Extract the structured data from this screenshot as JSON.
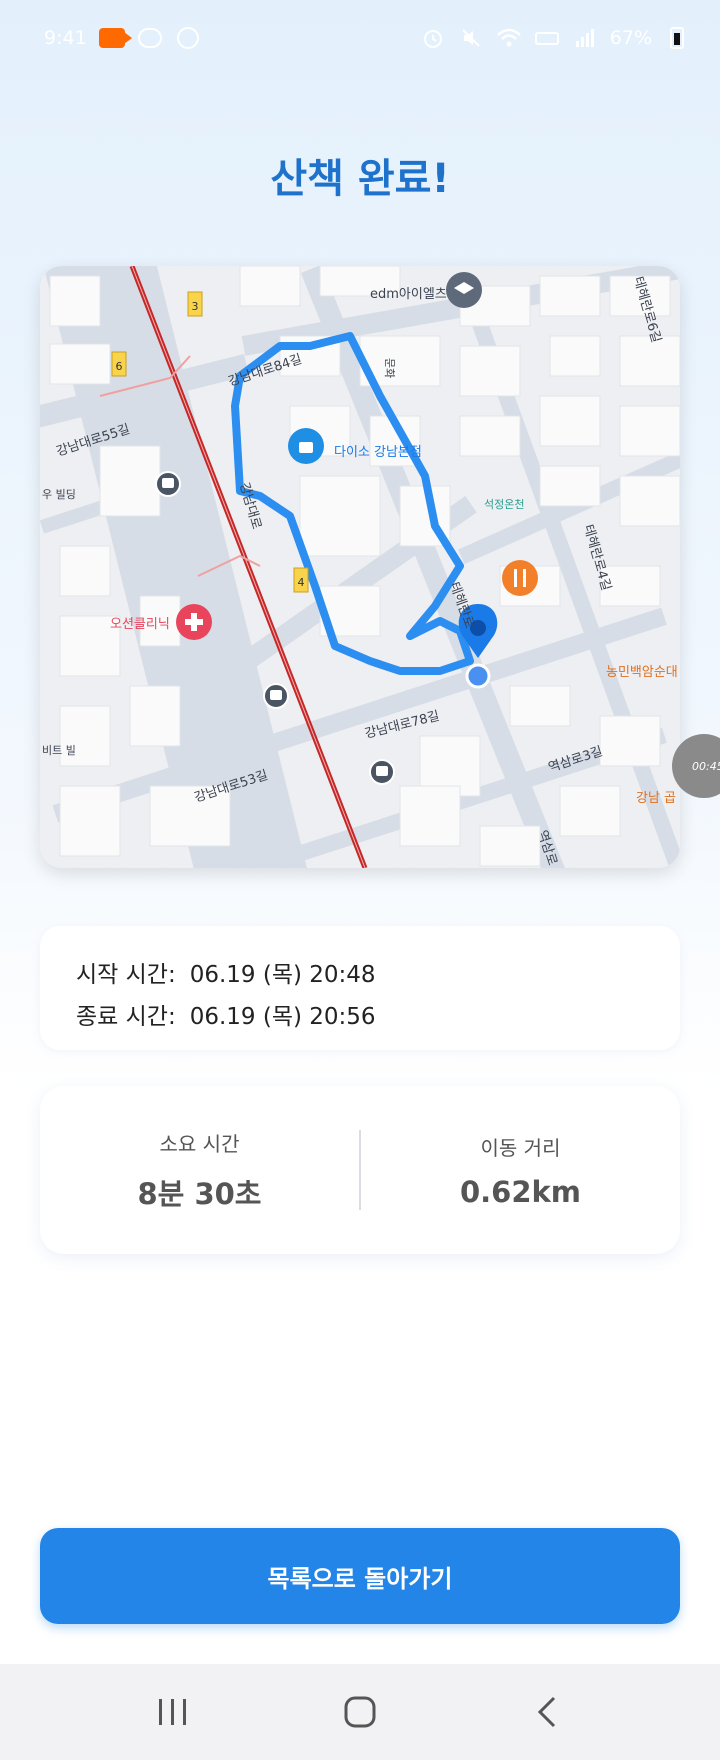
{
  "status_bar": {
    "time": "9:41",
    "battery": "67%"
  },
  "title": "산책 완료!",
  "map": {
    "labels": {
      "road_84": "강남대로84길",
      "road_55": "강남대로55길",
      "road_78": "강남대로78길",
      "road_53": "강남대로53길",
      "gangnam_daero": "강남대로",
      "teheran_6": "테헤란로6길",
      "teheran_4": "테헤란로4길",
      "teheran": "테헤란로",
      "yeoksam_3": "역삼로3길",
      "yeoksam": "역삼로",
      "woo_building": "우 빌딩",
      "bit_building": "비트 빌",
      "edm": "edm아이엘츠",
      "daiso": "다이소 강남본점",
      "seokjeong": "석정온천",
      "ocean_clinic": "오션클리닉",
      "nongmin": "농민백암순대",
      "gangnam_gop": "강남 곱",
      "badge_3": "3",
      "badge_6": "6",
      "badge_4": "4",
      "mun": "문화"
    },
    "colors": {
      "route": "#2c8ef0",
      "rail": "#c62828",
      "pin": "#1a7ae8"
    }
  },
  "times": {
    "start_label": "시작 시간:",
    "start_value": "06.19 (목) 20:48",
    "end_label": "종료 시간:",
    "end_value": "06.19 (목) 20:56"
  },
  "stats": {
    "duration_label": "소요 시간",
    "duration_value": "8분 30초",
    "distance_label": "이동 거리",
    "distance_value": "0.62km"
  },
  "floating_timer": "00:45",
  "button": {
    "back_label": "목록으로 돌아가기"
  },
  "icons": {
    "nav_recent": "recent-apps-icon",
    "nav_home": "home-icon",
    "nav_back": "back-icon"
  }
}
